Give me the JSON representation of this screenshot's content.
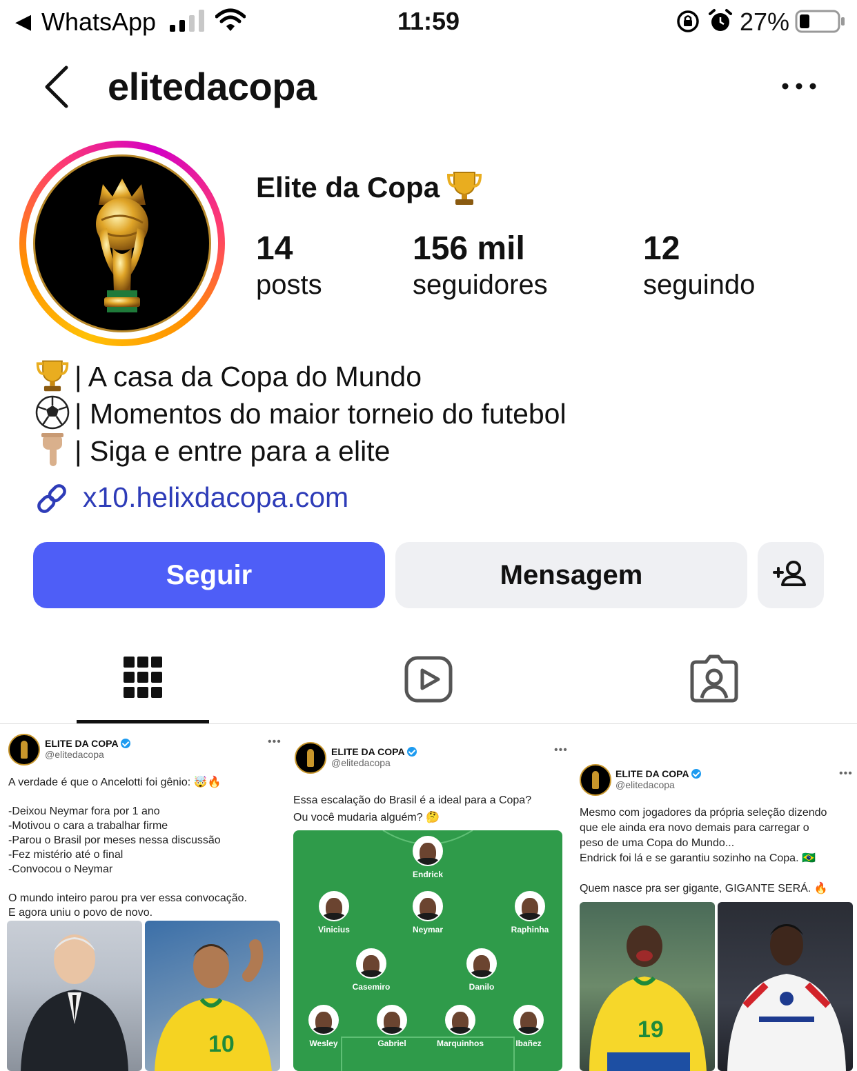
{
  "status_bar": {
    "back_app": "WhatsApp",
    "time": "11:59",
    "battery": "27%"
  },
  "header": {
    "username": "elitedacopa"
  },
  "profile": {
    "display_name": "Elite da Copa",
    "stats": [
      {
        "value": "14",
        "label": "posts"
      },
      {
        "value": "156 mil",
        "label": "seguidores"
      },
      {
        "value": "12",
        "label": "seguindo"
      }
    ],
    "bio": [
      {
        "emoji": "trophy",
        "text": "| A casa da Copa do Mundo"
      },
      {
        "emoji": "soccer-ball",
        "text": "| Momentos do maior torneio do futebol"
      },
      {
        "emoji": "pointing-down",
        "text": "| Siga e entre para a elite"
      }
    ],
    "link": "x10.helixdacopa.com"
  },
  "actions": {
    "follow": "Seguir",
    "message": "Mensagem"
  },
  "tabs": [
    {
      "name": "grid",
      "active": true
    },
    {
      "name": "reels",
      "active": false
    },
    {
      "name": "tagged",
      "active": false
    }
  ],
  "posts": [
    {
      "account_name": "ELITE DA COPA",
      "handle": "@elitedacopa",
      "text": "A verdade é que o Ancelotti foi gênio: 🤯🔥\n\n-Deixou Neymar fora por 1 ano\n-Motivou o cara a trabalhar firme\n-Parou o Brasil por meses nessa discussão\n-Fez mistério até o final\n-Convocou o Neymar\n\nO mundo inteiro parou pra ver essa convocação.\nE agora uniu o povo de novo."
    },
    {
      "account_name": "ELITE DA COPA",
      "handle": "@elitedacopa",
      "text": "Essa escalação do Brasil é a ideal para a Copa?\nOu você mudaria alguém? 🤔",
      "lineup": [
        "Endrick",
        "Vinicius",
        "Neymar",
        "Raphinha",
        "Casemiro",
        "Danilo",
        "Wesley",
        "Gabriel",
        "Marquinhos",
        "Ibañez"
      ]
    },
    {
      "account_name": "ELITE DA COPA",
      "handle": "@elitedacopa",
      "text": "Mesmo com jogadores da própria seleção dizendo\nque ele ainda era novo demais para carregar o\npeso de uma Copa do Mundo...\nEndrick foi lá e se garantiu sozinho na Copa. 🇧🇷\n\nQuem nasce pra ser gigante, GIGANTE SERÁ. 🔥"
    }
  ],
  "colors": {
    "follow_button": "#4e5ef7",
    "secondary_button": "#eff0f3",
    "link": "#2e3cb8",
    "pitch": "#2f9b4a"
  }
}
